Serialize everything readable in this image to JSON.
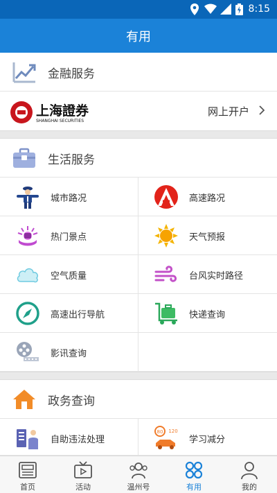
{
  "status_bar": {
    "time": "8:15"
  },
  "header": {
    "title": "有用"
  },
  "finance": {
    "heading": "金融服务",
    "brokerage": {
      "logo_text": "上海證券",
      "logo_subtext": "SHANGHAI SECURITIES",
      "action": "网上开户"
    }
  },
  "life": {
    "heading": "生活服务",
    "items": [
      {
        "label": "城市路况",
        "icon": "traffic-police-icon"
      },
      {
        "label": "高速路况",
        "icon": "highway-logo-icon"
      },
      {
        "label": "热门景点",
        "icon": "attraction-icon"
      },
      {
        "label": "天气预报",
        "icon": "sun-icon"
      },
      {
        "label": "空气质量",
        "icon": "cloud-icon"
      },
      {
        "label": "台风实时路径",
        "icon": "wind-icon"
      },
      {
        "label": "高速出行导航",
        "icon": "compass-icon"
      },
      {
        "label": "快递查询",
        "icon": "luggage-cart-icon"
      },
      {
        "label": "影讯查询",
        "icon": "film-reel-icon"
      }
    ]
  },
  "government": {
    "heading": "政务查询",
    "items": [
      {
        "label": "自助违法处理",
        "icon": "self-service-icon"
      },
      {
        "label": "学习减分",
        "icon": "speed-limit-car-icon"
      }
    ]
  },
  "tab_bar": {
    "tabs": [
      {
        "label": "首页",
        "icon": "newspaper-icon"
      },
      {
        "label": "活动",
        "icon": "tv-icon"
      },
      {
        "label": "温州号",
        "icon": "people-icon"
      },
      {
        "label": "有用",
        "icon": "grid-icon",
        "active": true
      },
      {
        "label": "我的",
        "icon": "user-icon"
      }
    ]
  },
  "colors": {
    "title_bar": "#1b82d8",
    "status_bar": "#0a66b8",
    "active_tab": "#1b82d8"
  }
}
